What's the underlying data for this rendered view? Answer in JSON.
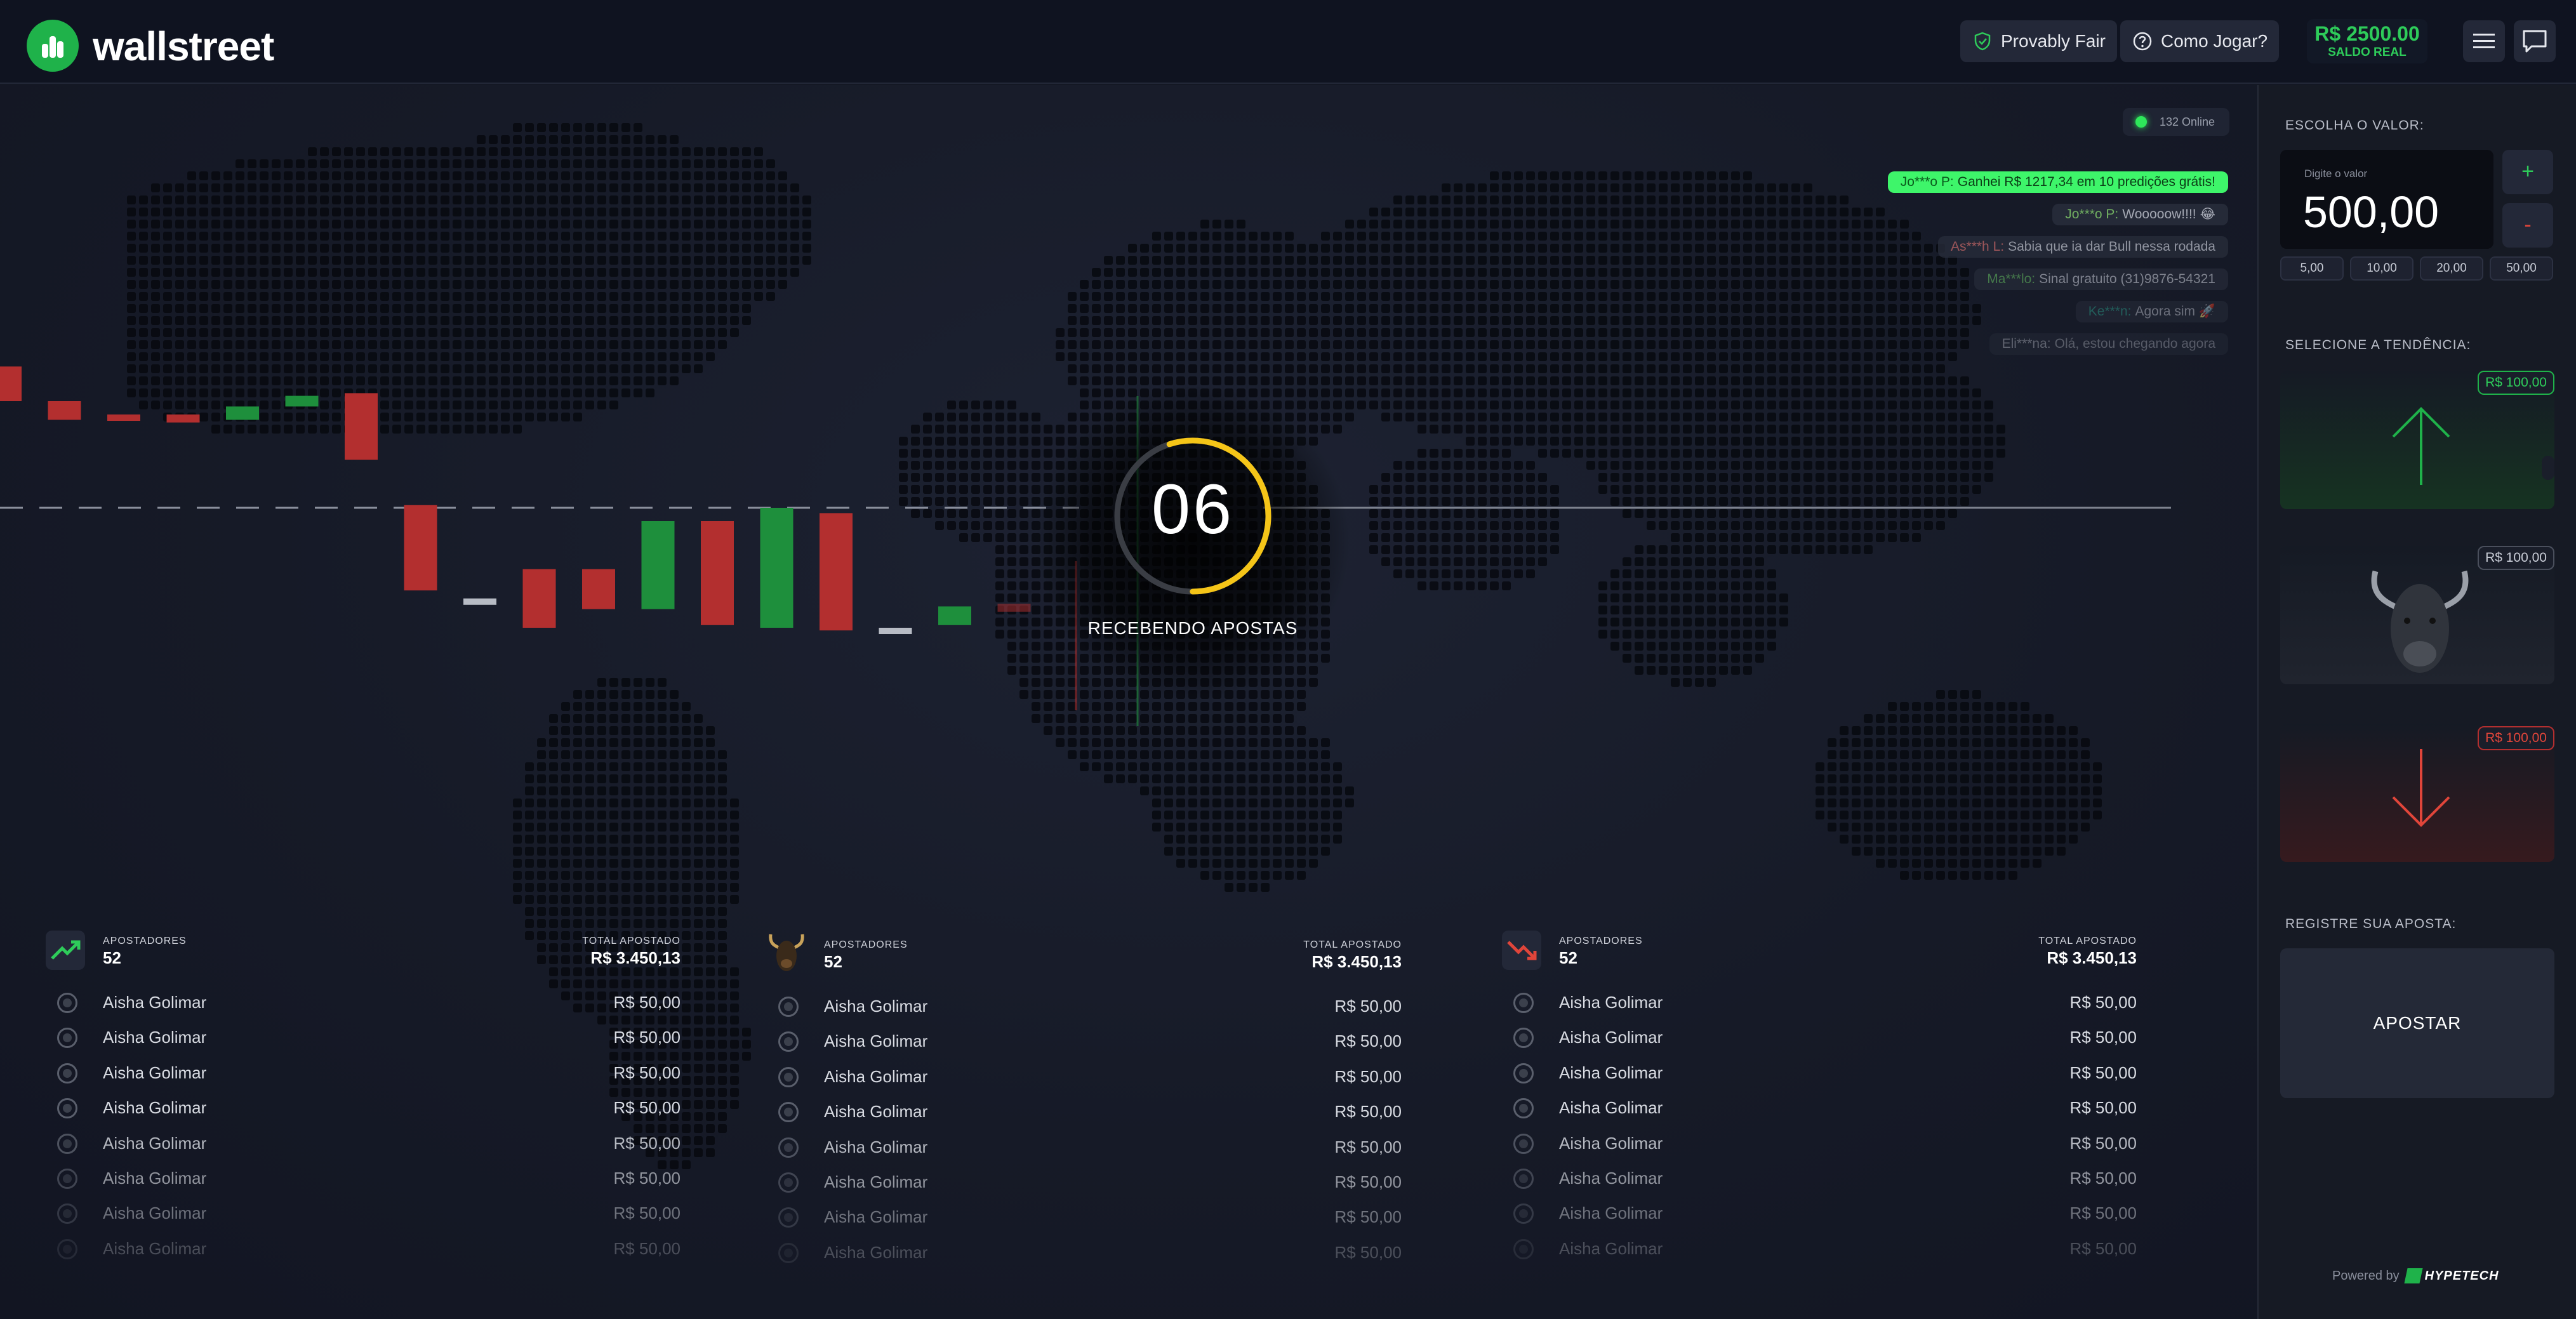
{
  "header": {
    "brand": "wallstreet",
    "provably_fair": "Provably Fair",
    "how_to_play": "Como Jogar?",
    "balance_amount": "R$ 2500.00",
    "balance_label": "SALDO REAL"
  },
  "online": {
    "text": "132 Online"
  },
  "messages": [
    {
      "user": "Jo***o P:",
      "text": "Ganhei R$ 1217,34 em 10 predições grátis!",
      "highlight": true
    },
    {
      "user": "Jo***o P:",
      "text": "Wooooow!!!! 😂"
    },
    {
      "user": "As***h L:",
      "text": "Sabia que ia dar Bull nessa rodada"
    },
    {
      "user": "Ma***lo:",
      "text": "Sinal gratuito (31)9876-54321"
    },
    {
      "user": "Ke***n:",
      "text": "Agora sim 🚀"
    },
    {
      "user": "Eli***na:",
      "text": "Olá, estou chegando agora"
    }
  ],
  "timer": {
    "value": "06",
    "status": "RECEBENDO APOSTAS",
    "progress": 0.55
  },
  "colors": {
    "green": "#1e8f3c",
    "red": "#b32f2f",
    "accent_green": "#2ecc5a",
    "timer_yellow": "#f5c518"
  },
  "candles": [
    {
      "open": 53,
      "close": 40
    },
    {
      "open": 40,
      "close": 33
    },
    {
      "open": 35,
      "close": 33
    },
    {
      "open": 35,
      "close": 32
    },
    {
      "open": 33,
      "close": 38
    },
    {
      "open": 38,
      "close": 42
    },
    {
      "open": 43,
      "close": 18
    },
    {
      "open": 1,
      "close": -31
    },
    {
      "open": -34,
      "close": -34
    },
    {
      "open": -23,
      "close": -45
    },
    {
      "open": -23,
      "close": -38
    },
    {
      "open": -38,
      "close": -5
    },
    {
      "open": -5,
      "close": -44
    },
    {
      "open": -45,
      "close": 0
    },
    {
      "open": -2,
      "close": -46
    },
    {
      "open": -45,
      "close": -45
    },
    {
      "open": -44,
      "close": -37
    },
    {
      "open": -36,
      "close": -39
    }
  ],
  "bettors": [
    {
      "trend": "up",
      "bettors_label": "APOSTADORES",
      "count": "52",
      "total_label": "TOTAL APOSTADO",
      "total": "R$ 3.450,13",
      "rows": [
        {
          "name": "Aisha Golimar",
          "amount": "R$ 50,00"
        },
        {
          "name": "Aisha Golimar",
          "amount": "R$ 50,00"
        },
        {
          "name": "Aisha Golimar",
          "amount": "R$ 50,00"
        },
        {
          "name": "Aisha Golimar",
          "amount": "R$ 50,00"
        },
        {
          "name": "Aisha Golimar",
          "amount": "R$ 50,00"
        },
        {
          "name": "Aisha Golimar",
          "amount": "R$ 50,00"
        },
        {
          "name": "Aisha Golimar",
          "amount": "R$ 50,00"
        },
        {
          "name": "Aisha Golimar",
          "amount": "R$ 50,00"
        }
      ]
    },
    {
      "trend": "bull",
      "bettors_label": "APOSTADORES",
      "count": "52",
      "total_label": "TOTAL APOSTADO",
      "total": "R$ 3.450,13",
      "rows": [
        {
          "name": "Aisha Golimar",
          "amount": "R$ 50,00"
        },
        {
          "name": "Aisha Golimar",
          "amount": "R$ 50,00"
        },
        {
          "name": "Aisha Golimar",
          "amount": "R$ 50,00"
        },
        {
          "name": "Aisha Golimar",
          "amount": "R$ 50,00"
        },
        {
          "name": "Aisha Golimar",
          "amount": "R$ 50,00"
        },
        {
          "name": "Aisha Golimar",
          "amount": "R$ 50,00"
        },
        {
          "name": "Aisha Golimar",
          "amount": "R$ 50,00"
        },
        {
          "name": "Aisha Golimar",
          "amount": "R$ 50,00"
        }
      ]
    },
    {
      "trend": "down",
      "bettors_label": "APOSTADORES",
      "count": "52",
      "total_label": "TOTAL APOSTADO",
      "total": "R$ 3.450,13",
      "rows": [
        {
          "name": "Aisha Golimar",
          "amount": "R$ 50,00"
        },
        {
          "name": "Aisha Golimar",
          "amount": "R$ 50,00"
        },
        {
          "name": "Aisha Golimar",
          "amount": "R$ 50,00"
        },
        {
          "name": "Aisha Golimar",
          "amount": "R$ 50,00"
        },
        {
          "name": "Aisha Golimar",
          "amount": "R$ 50,00"
        },
        {
          "name": "Aisha Golimar",
          "amount": "R$ 50,00"
        },
        {
          "name": "Aisha Golimar",
          "amount": "R$ 50,00"
        },
        {
          "name": "Aisha Golimar",
          "amount": "R$ 50,00"
        }
      ]
    }
  ],
  "sidebar": {
    "choose_value_label": "ESCOLHA O VALOR:",
    "amount_placeholder": "Digite o valor",
    "amount_value": "500,00",
    "plus": "+",
    "minus": "-",
    "quick_amounts": [
      "5,00",
      "10,00",
      "20,00",
      "50,00"
    ],
    "select_trend_label": "SELECIONE A TENDÊNCIA:",
    "trends": [
      {
        "kind": "up",
        "badge": "R$ 100,00"
      },
      {
        "kind": "bull",
        "badge": "R$ 100,00"
      },
      {
        "kind": "down",
        "badge": "R$ 100,00"
      }
    ],
    "register_label": "REGISTRE SUA APOSTA:",
    "bet_button": "APOSTAR",
    "powered_by": "Powered by",
    "provider": "HYPETECH"
  }
}
